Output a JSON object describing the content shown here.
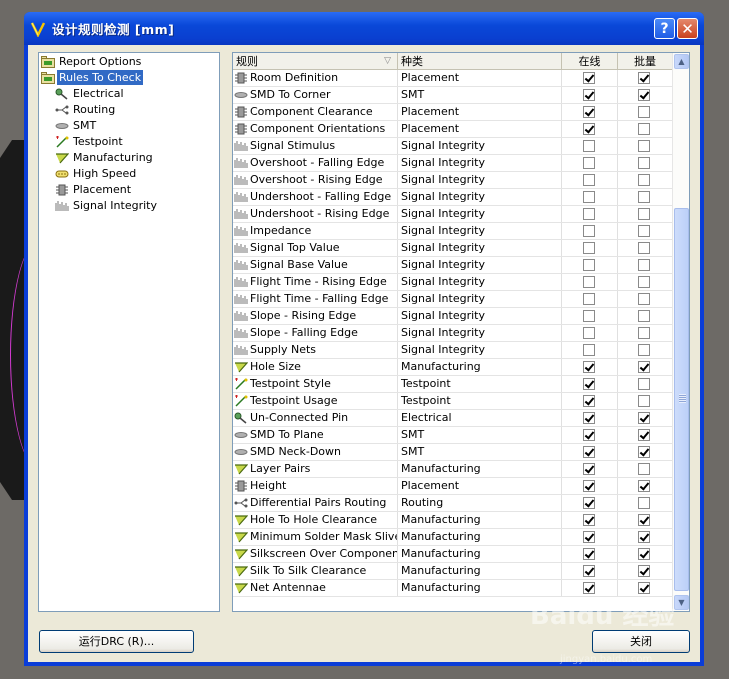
{
  "window": {
    "title": "设计规则检测 [mm]",
    "help_label": "?",
    "close_label": "✕"
  },
  "tree": {
    "items": [
      {
        "label": "Report Options",
        "icon": "report-options-icon",
        "level": 0
      },
      {
        "label": "Rules To Check",
        "icon": "rules-to-check-icon",
        "level": 0,
        "selected": true
      },
      {
        "label": "Electrical",
        "icon": "electrical-icon",
        "level": 1
      },
      {
        "label": "Routing",
        "icon": "routing-icon",
        "level": 1
      },
      {
        "label": "SMT",
        "icon": "smt-icon",
        "level": 1
      },
      {
        "label": "Testpoint",
        "icon": "testpoint-icon",
        "level": 1
      },
      {
        "label": "Manufacturing",
        "icon": "manufacturing-icon",
        "level": 1
      },
      {
        "label": "High Speed",
        "icon": "high-speed-icon",
        "level": 1
      },
      {
        "label": "Placement",
        "icon": "placement-icon",
        "level": 1
      },
      {
        "label": "Signal Integrity",
        "icon": "signal-integrity-icon",
        "level": 1
      }
    ]
  },
  "grid": {
    "headers": {
      "rule": "规则",
      "kind": "种类",
      "online": "在线",
      "batch": "批量"
    },
    "rows": [
      {
        "name": "Room Definition",
        "kind": "Placement",
        "icon": "placement",
        "online": true,
        "batch": true
      },
      {
        "name": "SMD To Corner",
        "kind": "SMT",
        "icon": "smt",
        "online": true,
        "batch": true
      },
      {
        "name": "Component Clearance",
        "kind": "Placement",
        "icon": "placement",
        "online": true,
        "batch": false
      },
      {
        "name": "Component Orientations",
        "kind": "Placement",
        "icon": "placement",
        "online": true,
        "batch": false
      },
      {
        "name": "Signal Stimulus",
        "kind": "Signal Integrity",
        "icon": "signal",
        "online": false,
        "batch": false
      },
      {
        "name": "Overshoot - Falling Edge",
        "kind": "Signal Integrity",
        "icon": "signal",
        "online": false,
        "batch": false
      },
      {
        "name": "Overshoot - Rising Edge",
        "kind": "Signal Integrity",
        "icon": "signal",
        "online": false,
        "batch": false
      },
      {
        "name": "Undershoot - Falling Edge",
        "kind": "Signal Integrity",
        "icon": "signal",
        "online": false,
        "batch": false
      },
      {
        "name": "Undershoot - Rising Edge",
        "kind": "Signal Integrity",
        "icon": "signal",
        "online": false,
        "batch": false
      },
      {
        "name": "Impedance",
        "kind": "Signal Integrity",
        "icon": "signal",
        "online": false,
        "batch": false
      },
      {
        "name": "Signal Top Value",
        "kind": "Signal Integrity",
        "icon": "signal",
        "online": false,
        "batch": false
      },
      {
        "name": "Signal Base Value",
        "kind": "Signal Integrity",
        "icon": "signal",
        "online": false,
        "batch": false
      },
      {
        "name": "Flight Time - Rising Edge",
        "kind": "Signal Integrity",
        "icon": "signal",
        "online": false,
        "batch": false
      },
      {
        "name": "Flight Time - Falling Edge",
        "kind": "Signal Integrity",
        "icon": "signal",
        "online": false,
        "batch": false
      },
      {
        "name": "Slope - Rising Edge",
        "kind": "Signal Integrity",
        "icon": "signal",
        "online": false,
        "batch": false
      },
      {
        "name": "Slope - Falling Edge",
        "kind": "Signal Integrity",
        "icon": "signal",
        "online": false,
        "batch": false
      },
      {
        "name": "Supply Nets",
        "kind": "Signal Integrity",
        "icon": "signal",
        "online": false,
        "batch": false
      },
      {
        "name": "Hole Size",
        "kind": "Manufacturing",
        "icon": "manufacturing",
        "online": true,
        "batch": true
      },
      {
        "name": "Testpoint Style",
        "kind": "Testpoint",
        "icon": "testpoint",
        "online": true,
        "batch": false
      },
      {
        "name": "Testpoint Usage",
        "kind": "Testpoint",
        "icon": "testpoint",
        "online": true,
        "batch": false
      },
      {
        "name": "Un-Connected Pin",
        "kind": "Electrical",
        "icon": "electrical",
        "online": true,
        "batch": true
      },
      {
        "name": "SMD To Plane",
        "kind": "SMT",
        "icon": "smt",
        "online": true,
        "batch": true
      },
      {
        "name": "SMD Neck-Down",
        "kind": "SMT",
        "icon": "smt",
        "online": true,
        "batch": true
      },
      {
        "name": "Layer Pairs",
        "kind": "Manufacturing",
        "icon": "manufacturing",
        "online": true,
        "batch": false
      },
      {
        "name": "Height",
        "kind": "Placement",
        "icon": "placement",
        "online": true,
        "batch": true
      },
      {
        "name": "Differential Pairs Routing",
        "kind": "Routing",
        "icon": "routing",
        "online": true,
        "batch": false
      },
      {
        "name": "Hole To Hole Clearance",
        "kind": "Manufacturing",
        "icon": "manufacturing",
        "online": true,
        "batch": true
      },
      {
        "name": "Minimum Solder Mask Sliver",
        "kind": "Manufacturing",
        "icon": "manufacturing",
        "online": true,
        "batch": true
      },
      {
        "name": "Silkscreen Over Component Pads",
        "kind": "Manufacturing",
        "icon": "manufacturing",
        "online": true,
        "batch": true
      },
      {
        "name": "Silk To Silk Clearance",
        "kind": "Manufacturing",
        "icon": "manufacturing",
        "online": true,
        "batch": true
      },
      {
        "name": "Net Antennae",
        "kind": "Manufacturing",
        "icon": "manufacturing",
        "online": true,
        "batch": true
      }
    ]
  },
  "buttons": {
    "run_drc": "运行DRC (R)...",
    "close": "关闭"
  },
  "watermark": {
    "brand": "Baidu 经验",
    "url": "jingyan.baidu.com"
  }
}
